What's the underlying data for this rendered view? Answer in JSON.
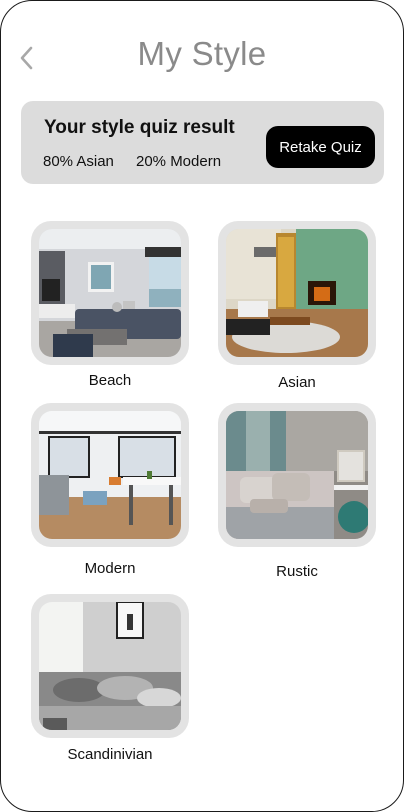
{
  "header": {
    "title": "My Style",
    "back_icon": "chevron-left-icon"
  },
  "quiz": {
    "title": "Your style quiz result",
    "results": [
      "80% Asian",
      "20% Modern"
    ],
    "retake_label": "Retake Quiz"
  },
  "styles": [
    {
      "label": "Beach"
    },
    {
      "label": "Asian"
    },
    {
      "label": "Modern"
    },
    {
      "label": "Rustic"
    },
    {
      "label": "Scandinivian"
    }
  ]
}
